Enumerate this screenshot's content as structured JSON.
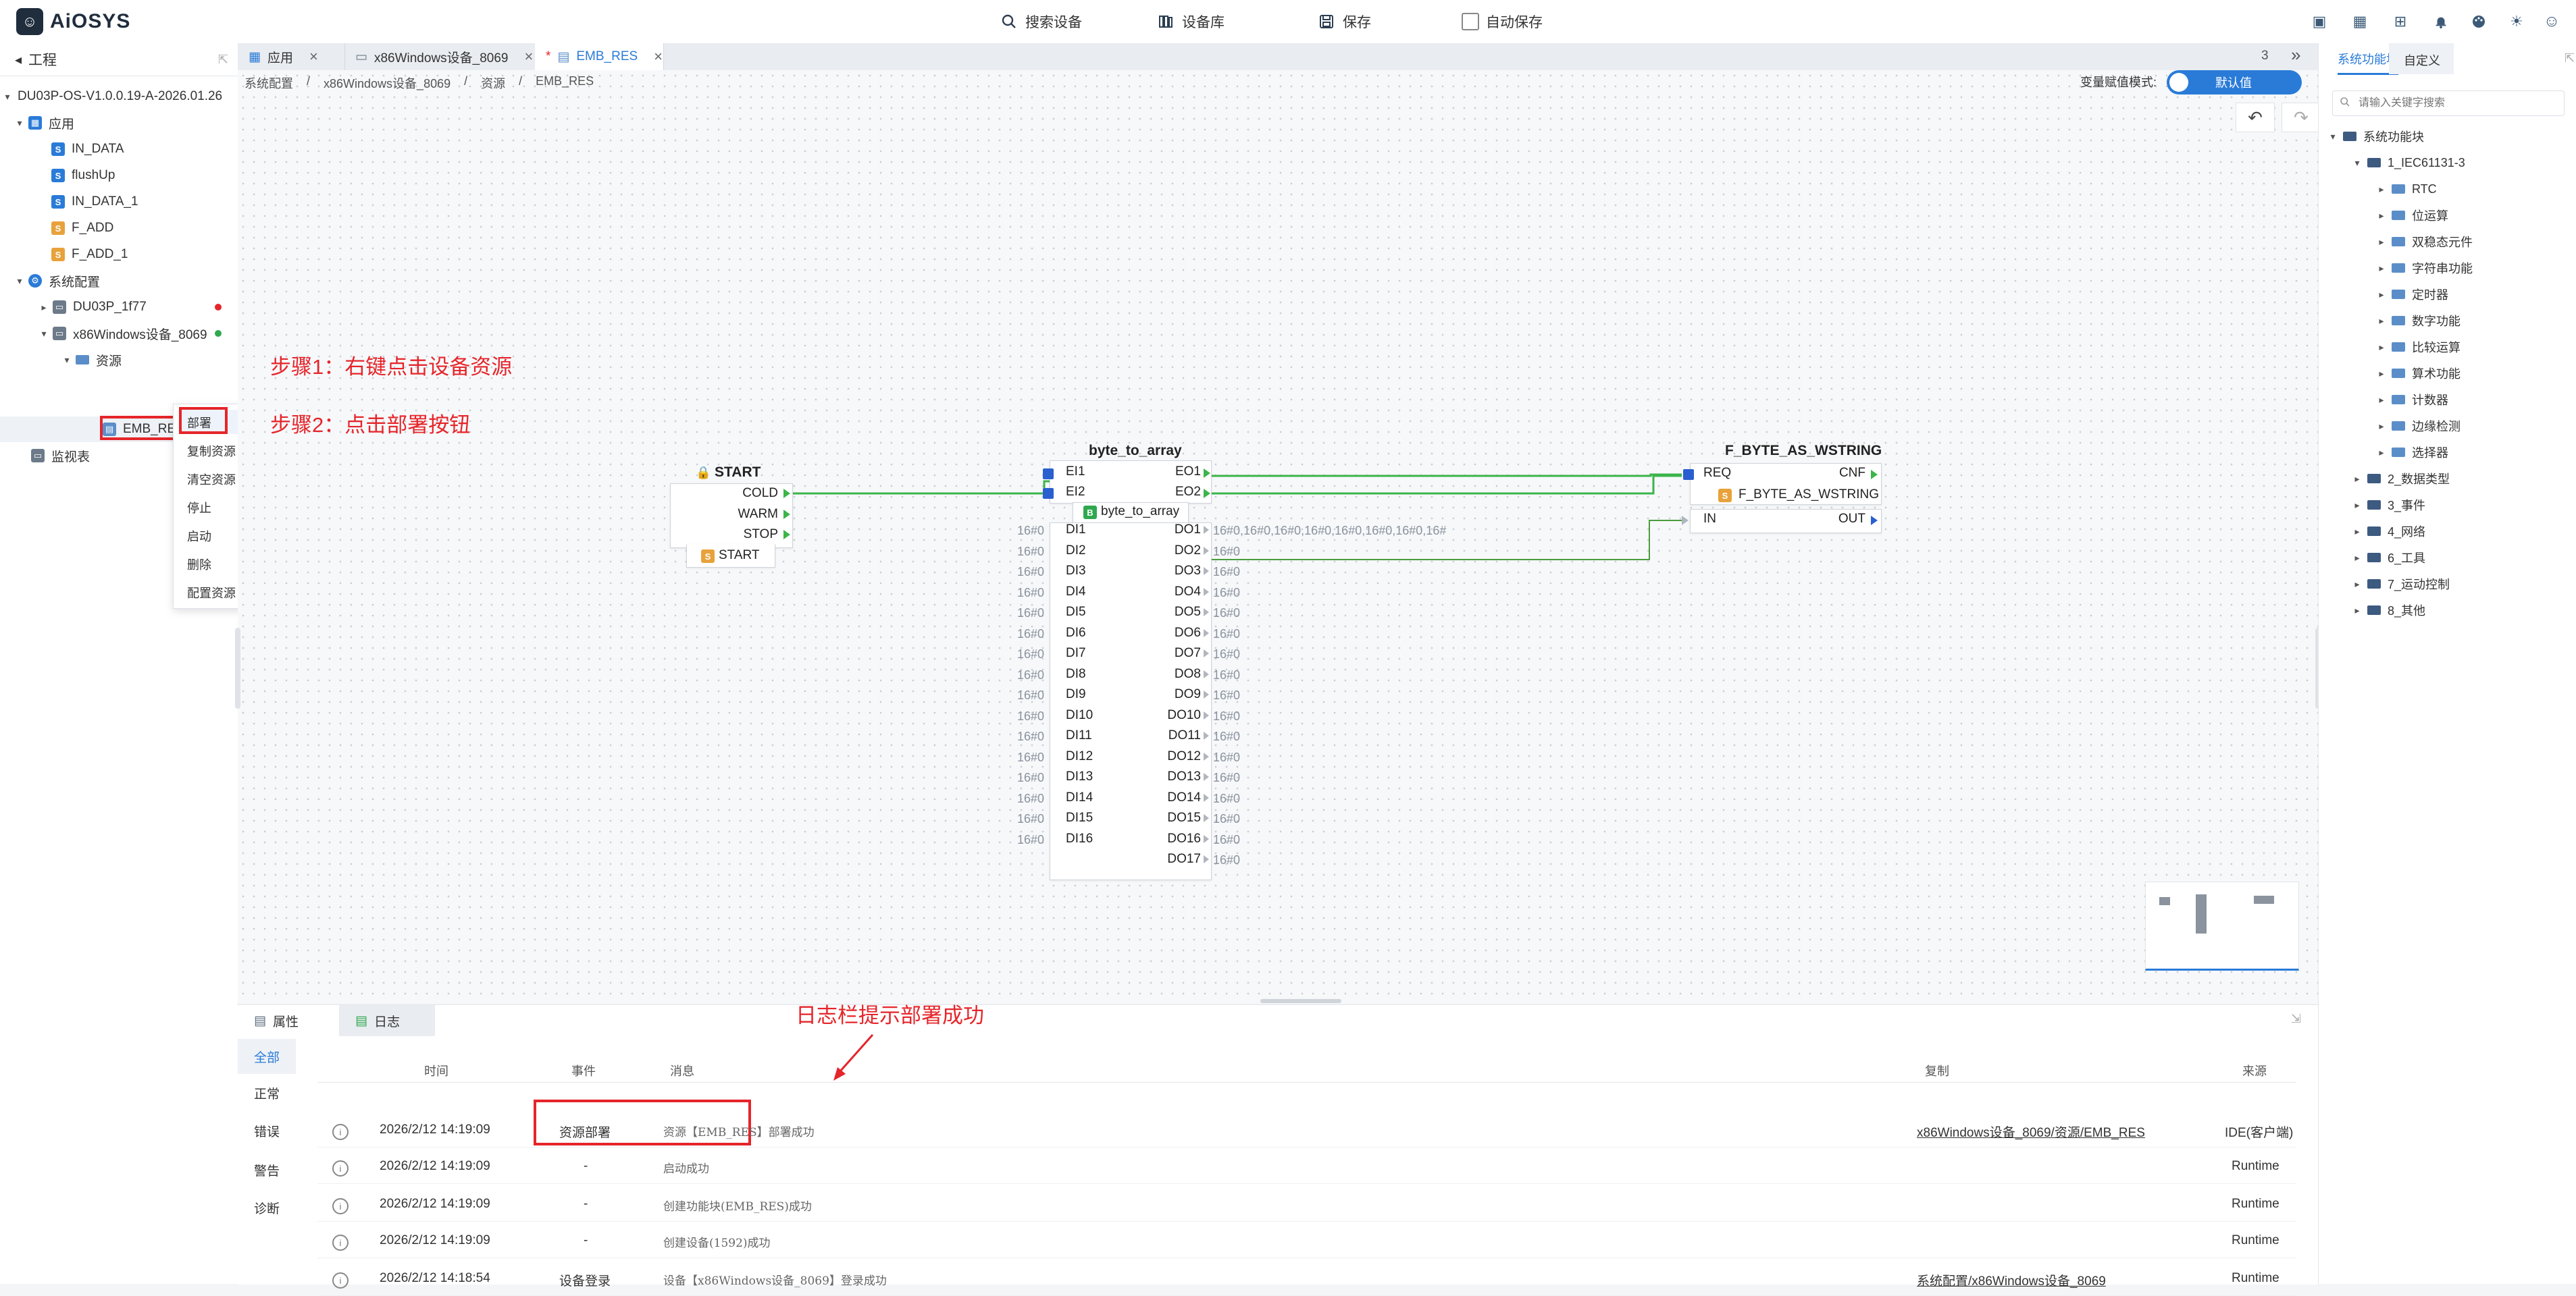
{
  "app": {
    "logo_text": "AiOSYS"
  },
  "toolbar": {
    "search_label": "搜索设备",
    "library_label": "设备库",
    "save_label": "保存",
    "autosave_label": "自动保存"
  },
  "left_panel": {
    "title": "工程",
    "tree": [
      {
        "label": "DU03P-OS-V1.0.0.19-A-2026.01.26"
      },
      {
        "label": "应用"
      },
      {
        "label": "IN_DATA"
      },
      {
        "label": "flushUp"
      },
      {
        "label": "IN_DATA_1"
      },
      {
        "label": "F_ADD"
      },
      {
        "label": "F_ADD_1"
      },
      {
        "label": "系统配置"
      },
      {
        "label": "DU03P_1f77"
      },
      {
        "label": "x86Windows设备_8069"
      },
      {
        "label": "资源"
      },
      {
        "label": "EMB_RES"
      },
      {
        "label": "监视表"
      }
    ],
    "status_colors": {
      "offline": "#e5252a",
      "online": "#2fa84f"
    }
  },
  "context_menu": {
    "items": [
      "部署",
      "复制资源",
      "清空资源",
      "停止",
      "启动",
      "删除",
      "配置资源"
    ]
  },
  "tabs": [
    {
      "label": "应用"
    },
    {
      "label": "x86Windows设备_8069"
    },
    {
      "label": "EMB_RES",
      "modified_marker": "*"
    }
  ],
  "tab_count": "3",
  "breadcrumb": [
    "系统配置",
    "x86Windows设备_8069",
    "资源",
    "EMB_RES"
  ],
  "var_mode": {
    "label": "变量赋值模式:",
    "value": "默认值"
  },
  "annotations": {
    "step1": "步骤1：右键点击设备资源",
    "step2": "步骤2：点击部署按钮",
    "log_hint": "日志栏提示部署成功"
  },
  "blocks": {
    "start": {
      "title": "START",
      "outputs": [
        "COLD",
        "WARM",
        "STOP"
      ],
      "type_label": "START"
    },
    "byte_to_array": {
      "title": "byte_to_array",
      "events_in": [
        "EI1",
        "EI2"
      ],
      "events_out": [
        "EO1",
        "EO2"
      ],
      "type_label": "byte_to_array",
      "inputs": [
        "DI1",
        "DI2",
        "DI3",
        "DI4",
        "DI5",
        "DI6",
        "DI7",
        "DI8",
        "DI9",
        "DI10",
        "DI11",
        "DI12",
        "DI13",
        "DI14",
        "DI15",
        "DI16"
      ],
      "outputs": [
        "DO1",
        "DO2",
        "DO3",
        "DO4",
        "DO5",
        "DO6",
        "DO7",
        "DO8",
        "DO9",
        "DO10",
        "DO11",
        "DO12",
        "DO13",
        "DO14",
        "DO15",
        "DO16",
        "DO17"
      ],
      "input_value": "16#0",
      "output_value": "16#0",
      "do1_value": "16#0,16#0,16#0,16#0,16#0,16#0,16#0,16#"
    },
    "f_byte_as_wstring": {
      "title": "F_BYTE_AS_WSTRING",
      "event_in": "REQ",
      "event_out": "CNF",
      "type_label": "F_BYTE_AS_WSTRING",
      "data_in": "IN",
      "data_out": "OUT"
    }
  },
  "bottom_panel": {
    "tabs": [
      "属性",
      "日志"
    ],
    "filters": [
      "全部",
      "正常",
      "错误",
      "警告",
      "诊断"
    ],
    "columns": {
      "time": "时间",
      "event": "事件",
      "message": "消息",
      "copy": "复制",
      "source": "来源"
    },
    "rows": [
      {
        "time": "2026/2/12 14:19:09",
        "event": "资源部署",
        "message": "资源【EMB_RES】部署成功",
        "copy": "x86Windows设备_8069/资源/EMB_RES",
        "source": "IDE(客户端)"
      },
      {
        "time": "2026/2/12 14:19:09",
        "event": "-",
        "message": "启动成功",
        "copy": "",
        "source": "Runtime"
      },
      {
        "time": "2026/2/12 14:19:09",
        "event": "-",
        "message": "创建功能块(EMB_RES)成功",
        "copy": "",
        "source": "Runtime"
      },
      {
        "time": "2026/2/12 14:19:09",
        "event": "-",
        "message": "创建设备(1592)成功",
        "copy": "",
        "source": "Runtime"
      },
      {
        "time": "2026/2/12 14:18:54",
        "event": "设备登录",
        "message": "设备【x86Windows设备_8069】登录成功",
        "copy": "系统配置/x86Windows设备_8069",
        "source": "Runtime"
      }
    ]
  },
  "right_panel": {
    "tabs": [
      "系统功能块",
      "自定义"
    ],
    "search_placeholder": "请输入关键字搜索",
    "tree": [
      {
        "label": "系统功能块"
      },
      {
        "label": "1_IEC61131-3"
      },
      {
        "label": "RTC"
      },
      {
        "label": "位运算"
      },
      {
        "label": "双稳态元件"
      },
      {
        "label": "字符串功能"
      },
      {
        "label": "定时器"
      },
      {
        "label": "数字功能"
      },
      {
        "label": "比较运算"
      },
      {
        "label": "算术功能"
      },
      {
        "label": "计数器"
      },
      {
        "label": "边缘检测"
      },
      {
        "label": "选择器"
      },
      {
        "label": "2_数据类型"
      },
      {
        "label": "3_事件"
      },
      {
        "label": "4_网络"
      },
      {
        "label": "6_工具"
      },
      {
        "label": "7_运动控制"
      },
      {
        "label": "8_其他"
      }
    ]
  },
  "colors": {
    "accent": "#2a7bd8",
    "annotation": "#e5252a",
    "event_wire": "#3bb54a",
    "data_wire": "#4a9d3c"
  }
}
